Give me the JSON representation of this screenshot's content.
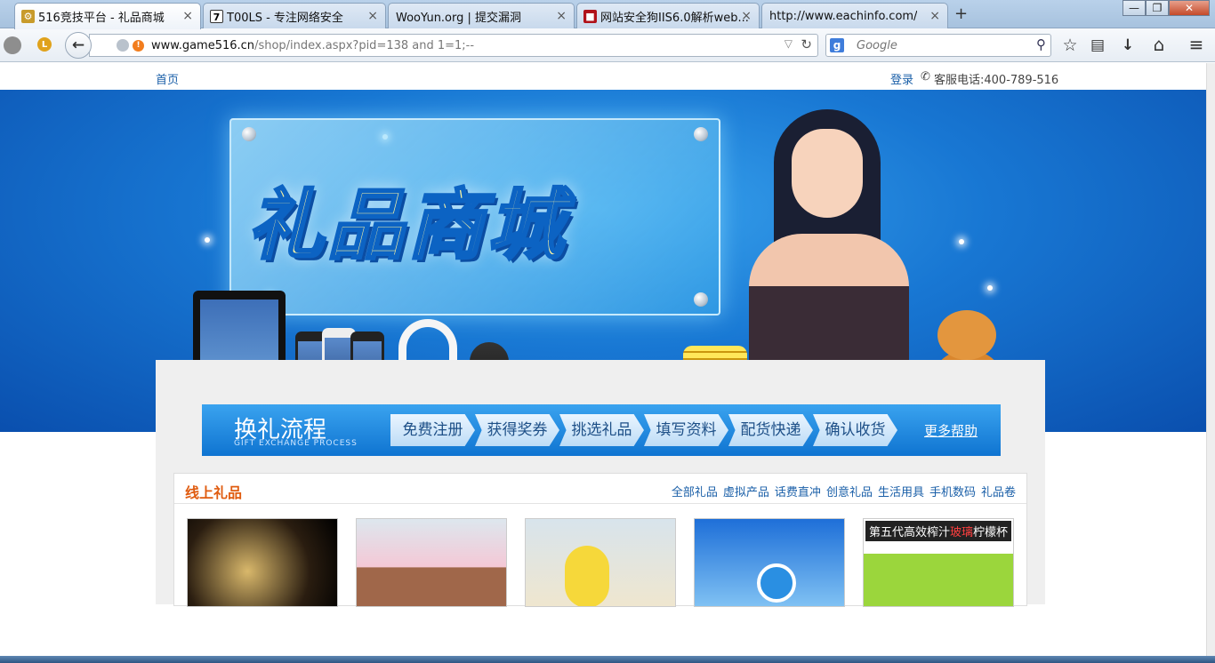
{
  "browser": {
    "tabs": [
      {
        "title": "516竞技平台 - 礼品商城",
        "icon": "game-favicon",
        "active": true
      },
      {
        "title": "T00LS - 专注网络安全",
        "icon": "t00ls-favicon",
        "active": false
      },
      {
        "title": "WooYun.org | 提交漏洞",
        "icon": "blank-favicon",
        "active": false
      },
      {
        "title": "网站安全狗IIS6.0解析web...",
        "icon": "shield-favicon",
        "active": false
      },
      {
        "title": "http://www.eachinfo.com/",
        "icon": "blank-favicon",
        "active": false
      }
    ],
    "close_glyph": "×",
    "new_tab_glyph": "+",
    "url_host": "www.game516.cn",
    "url_path": "/shop/index.aspx?pid=138 and 1=1;--",
    "search_engine_letter": "g",
    "search_placeholder": "Google",
    "window_controls": {
      "minimize": "—",
      "maximize": "❐",
      "close": "✕"
    },
    "toolbar_icons": {
      "back": "←",
      "bookmark": "☆",
      "library": "▤",
      "download": "↓",
      "home": "⌂",
      "menu": "≡",
      "reload": "↻",
      "dropdown": "▽",
      "search": "⚲"
    }
  },
  "page": {
    "topbar": {
      "home": "首页",
      "login": "登录",
      "hotline": "客服电话:400-789-516",
      "phone_icon": "✆"
    },
    "banner": {
      "title": "礼品商城"
    },
    "flow": {
      "title": "换礼流程",
      "subtitle": "GIFT EXCHANGE PROCESS",
      "steps": [
        "免费注册",
        "获得奖券",
        "挑选礼品",
        "填写资料",
        "配货快递",
        "确认收货"
      ],
      "more": "更多帮助"
    },
    "gifts": {
      "title": "线上礼品",
      "categories": [
        "全部礼品",
        "虚拟产品",
        "话费直冲",
        "创意礼品",
        "生活用具",
        "手机数码",
        "礼品卷"
      ],
      "thumb_label_prefix": "第五代高效榨汁",
      "thumb_label_highlight": "玻璃",
      "thumb_label_suffix": "柠檬杯"
    }
  },
  "colors": {
    "banner_blue": "#1877d3",
    "accent_orange": "#e05c10",
    "link_blue": "#1a5fa8"
  }
}
